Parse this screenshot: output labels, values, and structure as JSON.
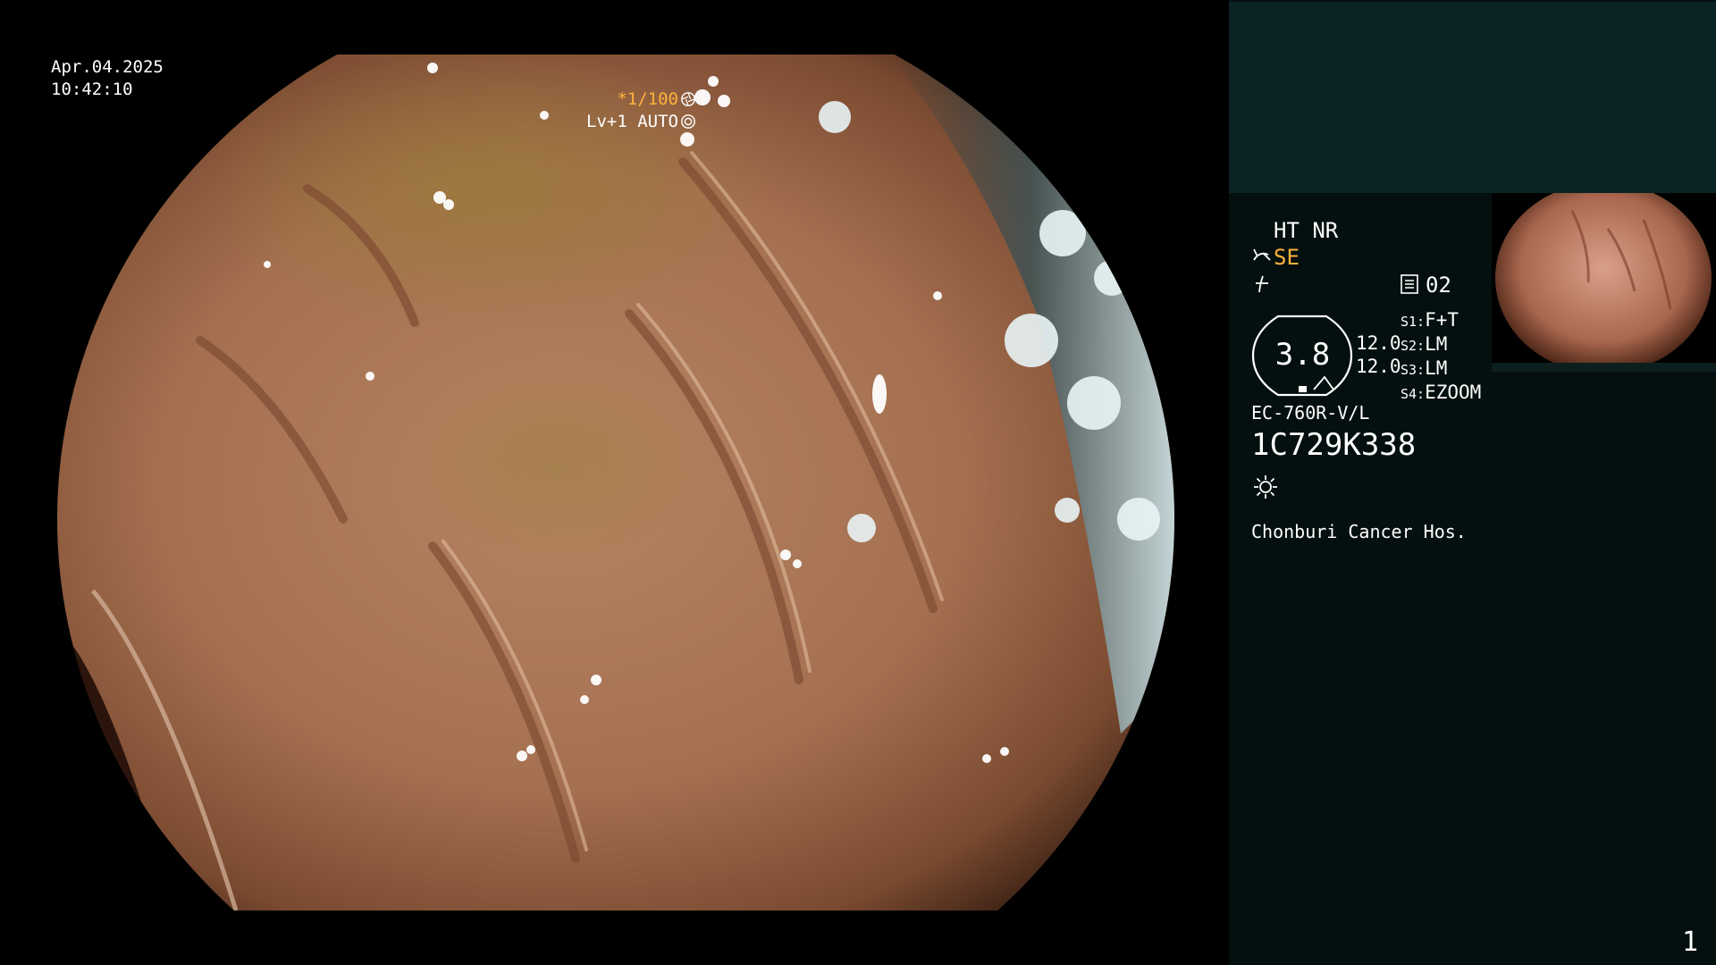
{
  "overlay": {
    "date": "Apr.04.2025",
    "time": "10:42:10",
    "shutter": "*1/100",
    "level": "Lv+1 AUTO"
  },
  "panel": {
    "mode": "HT NR",
    "se": "SE",
    "memory_number": "02",
    "zoom_value": "3.8",
    "value_top": "12.0",
    "value_bottom": "12.0",
    "switches": [
      {
        "key": "S1:",
        "value": "F+T"
      },
      {
        "key": "S2:",
        "value": "LM"
      },
      {
        "key": "S3:",
        "value": "LM"
      },
      {
        "key": "S4:",
        "value": "EZOOM"
      }
    ],
    "scope_model": "EC-760R-V/L",
    "serial": "1C729K338",
    "hospital": "Chonburi Cancer Hos.",
    "page_number": "1"
  },
  "colors": {
    "accent_orange": "#ffb23c",
    "panel_bg": "#03100f",
    "panel_header": "#0a2424"
  },
  "icons": [
    "aperture-icon",
    "iris-icon",
    "lamp-icon",
    "filter-icon",
    "memory-icon",
    "brightness-icon"
  ]
}
